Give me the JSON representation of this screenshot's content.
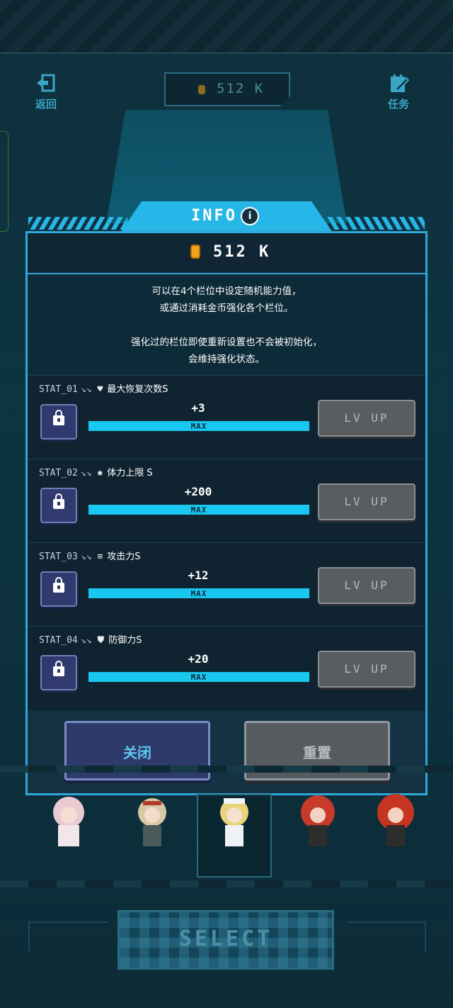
{
  "topbar": {
    "back_label": "返回",
    "coin_value": "512 K",
    "task_label": "任务"
  },
  "modal": {
    "title": "INFO",
    "coin_value": "512 K",
    "description": [
      "可以在4个栏位中设定随机能力值，",
      "或通过消耗金币强化各个栏位。",
      "强化过的栏位即使重新设置也不会被初始化，",
      "会维持强化状态。"
    ],
    "stats": [
      {
        "slot": "STAT_01",
        "arrows": "↘↘",
        "icon": "heart-icon",
        "icon_glyph": "♥",
        "name": "最大恢复次数S",
        "value": "+3",
        "bar_label": "MAX",
        "button": "LV UP"
      },
      {
        "slot": "STAT_02",
        "arrows": "↘↘",
        "icon": "asterisk-icon",
        "icon_glyph": "✱",
        "name": "体力上限 S",
        "value": "+200",
        "bar_label": "MAX",
        "button": "LV UP"
      },
      {
        "slot": "STAT_03",
        "arrows": "↘↘",
        "icon": "attack-icon",
        "icon_glyph": "≡",
        "name": "攻击力S",
        "value": "+12",
        "bar_label": "MAX",
        "button": "LV UP"
      },
      {
        "slot": "STAT_04",
        "arrows": "↘↘",
        "icon": "shield-icon",
        "icon_glyph": "⛊",
        "name": "防御力S",
        "value": "+20",
        "bar_label": "MAX",
        "button": "LV UP"
      }
    ],
    "close_label": "关闭",
    "reset_label": "重置"
  },
  "select_label": "SELECT",
  "colors": {
    "accent": "#27b6e8",
    "bar_fill": "#19c8f0",
    "lock_button": "#303a6e",
    "disabled_button": "#5a5d60",
    "coin": "#f2a51c"
  }
}
